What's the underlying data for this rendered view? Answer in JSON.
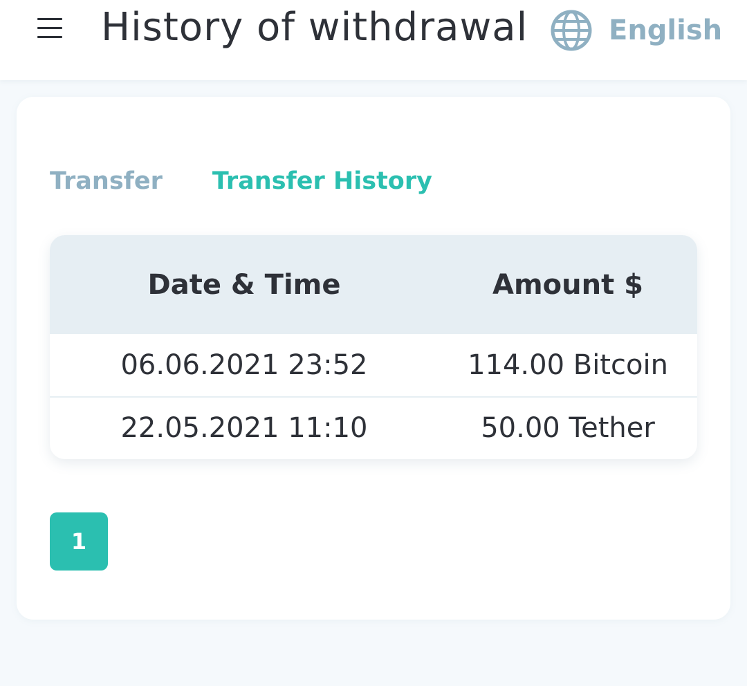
{
  "header": {
    "title": "History of withdrawal",
    "language": "English"
  },
  "icons": {
    "menu": "menu-icon",
    "language": "globe-icon"
  },
  "tabs": [
    {
      "label": "Transfer",
      "active": false
    },
    {
      "label": "Transfer History",
      "active": true
    }
  ],
  "table": {
    "columns": [
      "Date & Time",
      "Amount $"
    ],
    "rows": [
      {
        "datetime": "06.06.2021 23:52",
        "amount": "114.00 Bitcoin"
      },
      {
        "datetime": "22.05.2021 11:10",
        "amount": "50.00 Tether"
      }
    ]
  },
  "pagination": {
    "current": "1"
  },
  "colors": {
    "accent": "#2bbfb0",
    "muted": "#8fb0c2",
    "text": "#2e3138",
    "header_bg": "#e6eef3"
  }
}
